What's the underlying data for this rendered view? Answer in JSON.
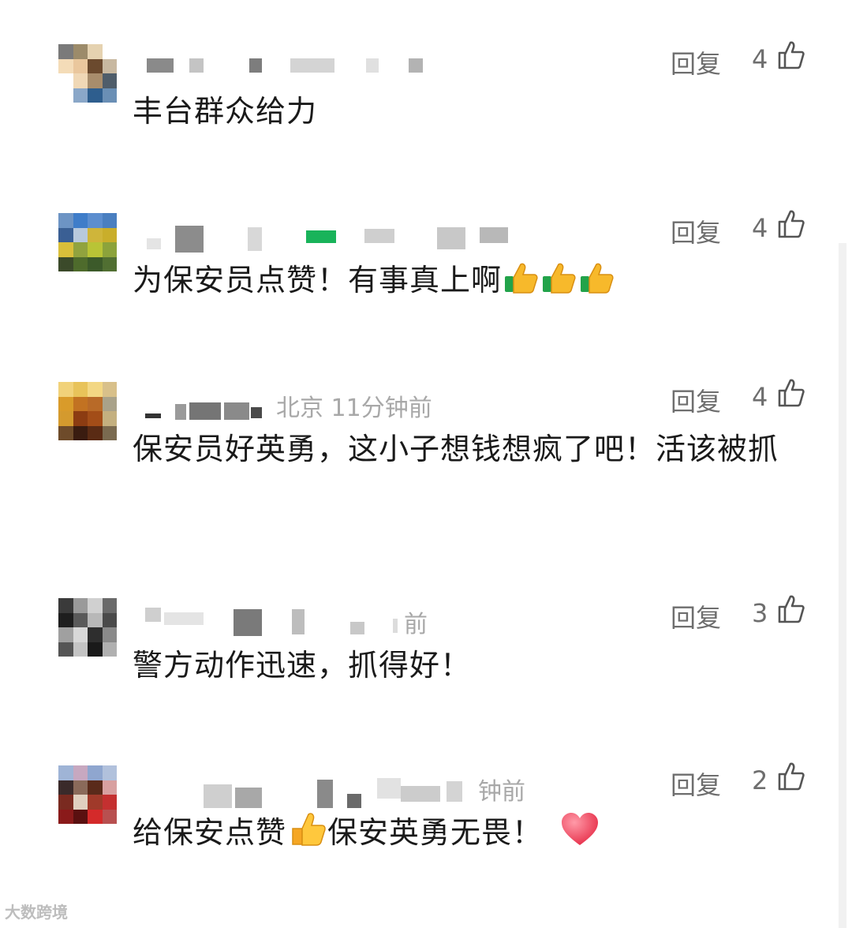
{
  "comments": [
    {
      "location_time": "",
      "reply_label": "回复",
      "likes": "4",
      "text": "丰台群众给力",
      "emoji": []
    },
    {
      "location_time": "",
      "reply_label": "回复",
      "likes": "4",
      "text": "为保安员点赞！有事真上啊",
      "emoji": [
        "thumbs-up",
        "thumbs-up",
        "thumbs-up"
      ]
    },
    {
      "location_time": "北京 11分钟前",
      "reply_label": "回复",
      "likes": "4",
      "text": "保安员好英勇，这小子想钱想疯了吧！活该被抓",
      "emoji": []
    },
    {
      "location_time": "前",
      "reply_label": "回复",
      "likes": "3",
      "text": "警方动作迅速，抓得好！",
      "emoji": []
    },
    {
      "location_time": "钟前",
      "reply_label": "回复",
      "likes": "2",
      "text_a": "给保安点赞",
      "text_b": "保安英勇无畏！",
      "emoji": [
        "thumbs-up",
        "red-heart"
      ]
    }
  ],
  "watermark": "大数跨境",
  "colors": {
    "text": "#1a1a1a",
    "meta": "#a8a8a8",
    "action": "#6e6e6e"
  }
}
